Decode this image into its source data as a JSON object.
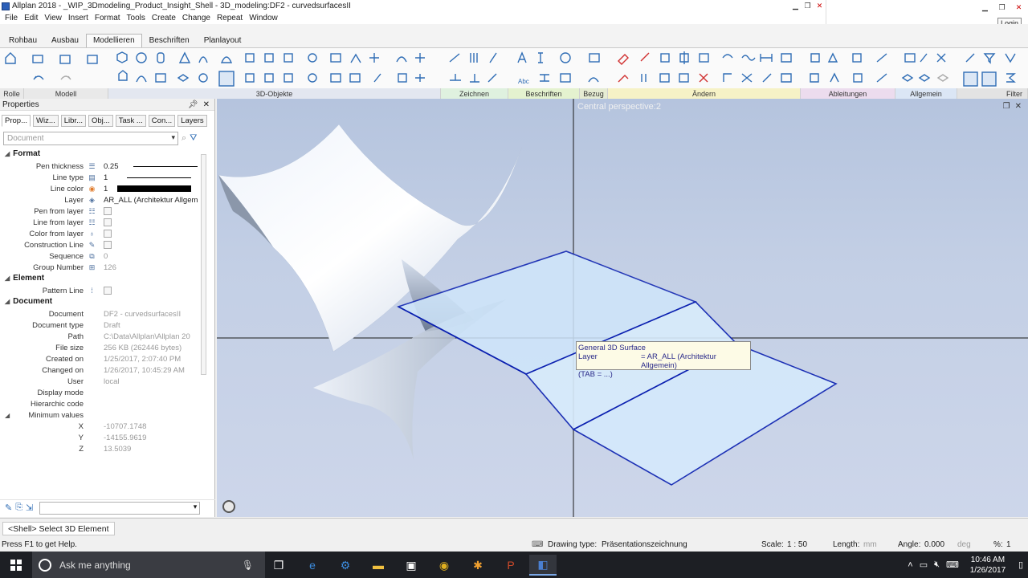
{
  "window": {
    "title": "Allplan 2018 - _WIP_3Dmodeling_Product_Insight_Shell - 3D_modeling:DF2 - curvedsurfacesII",
    "login": "Login"
  },
  "menu": [
    "File",
    "Edit",
    "View",
    "Insert",
    "Format",
    "Tools",
    "Create",
    "Change",
    "Repeat",
    "Window"
  ],
  "tabs": [
    {
      "label": "Rohbau",
      "active": false
    },
    {
      "label": "Ausbau",
      "active": false
    },
    {
      "label": "Modellieren",
      "active": true
    },
    {
      "label": "Beschriften",
      "active": false
    },
    {
      "label": "Planlayout",
      "active": false
    }
  ],
  "ribbon_groups": [
    {
      "label": "Rolle",
      "color": "#e9e9e9"
    },
    {
      "label": "Modell",
      "color": "#e9e9e9"
    },
    {
      "label": "3D-Objekte",
      "color": "#e3e7f0"
    },
    {
      "label": "Zeichnen",
      "color": "#dff1df"
    },
    {
      "label": "Beschriften",
      "color": "#e4f2cf"
    },
    {
      "label": "Bezug",
      "color": "#e6ecd3"
    },
    {
      "label": "Ändern",
      "color": "#f6f2c6"
    },
    {
      "label": "Ableitungen",
      "color": "#ecdcee"
    },
    {
      "label": "Allgemein",
      "color": "#dbe6f5"
    },
    {
      "label": "Filter",
      "color": "#e3e3e3"
    }
  ],
  "properties": {
    "title": "Properties",
    "tabs": [
      "Prop...",
      "Wiz...",
      "Libr...",
      "Obj...",
      "Task ...",
      "Con...",
      "Layers"
    ],
    "document_placeholder": "Document",
    "sections": {
      "format": "Format",
      "element": "Element",
      "document": "Document"
    },
    "format": {
      "pen_thickness": {
        "label": "Pen thickness",
        "value": "0.25"
      },
      "line_type": {
        "label": "Line type",
        "value": "1"
      },
      "line_color": {
        "label": "Line color",
        "value": "1"
      },
      "layer": {
        "label": "Layer",
        "value": "AR_ALL (Architektur Allgem"
      },
      "pen_from_layer": {
        "label": "Pen from layer"
      },
      "line_from_layer": {
        "label": "Line from layer"
      },
      "color_from_layer": {
        "label": "Color from layer"
      },
      "construction_line": {
        "label": "Construction Line"
      },
      "sequence": {
        "label": "Sequence",
        "value": "0"
      },
      "group_number": {
        "label": "Group Number",
        "value": "126"
      }
    },
    "element": {
      "pattern_line": {
        "label": "Pattern Line"
      }
    },
    "document": {
      "document": {
        "label": "Document",
        "value": "DF2 - curvedsurfacesII"
      },
      "document_type": {
        "label": "Document type",
        "value": "Draft"
      },
      "path": {
        "label": "Path",
        "value": "C:\\Data\\Allplan\\Allplan 20"
      },
      "file_size": {
        "label": "File size",
        "value": "256 KB (262446 bytes)"
      },
      "created_on": {
        "label": "Created on",
        "value": "1/25/2017, 2:07:40 PM"
      },
      "changed_on": {
        "label": "Changed on",
        "value": "1/26/2017, 10:45:29 AM"
      },
      "user": {
        "label": "User",
        "value": "local"
      },
      "display_mode": {
        "label": "Display mode"
      },
      "hierarchic_code": {
        "label": "Hierarchic code"
      },
      "minimum_values": {
        "label": "Minimum values"
      },
      "x": {
        "label": "X",
        "value": "-10707.1748"
      },
      "y": {
        "label": "Y",
        "value": "-14155.9619"
      },
      "z": {
        "label": "Z",
        "value": "13.5039"
      }
    }
  },
  "viewport": {
    "title": "Central perspective:2",
    "tooltip": {
      "line1": "General 3D Surface",
      "layer_key": "Layer",
      "layer_value": "= AR_ALL (Architektur Allgemein)",
      "line3": "(TAB = ...)"
    }
  },
  "command": "<Shell> Select 3D Element",
  "status": {
    "help": "Press F1 to get Help.",
    "drawing_type_label": "Drawing type:",
    "drawing_type": "Präsentationszeichnung",
    "scale_label": "Scale:",
    "scale": "1 : 50",
    "length_label": "Length:",
    "length_unit": "mm",
    "angle_label": "Angle:",
    "angle": "0.000",
    "angle_unit": "deg",
    "percent_label": "%:",
    "percent": "1"
  },
  "taskbar": {
    "search_placeholder": "Ask me anything",
    "time": "10:46 AM",
    "date": "1/26/2017"
  }
}
